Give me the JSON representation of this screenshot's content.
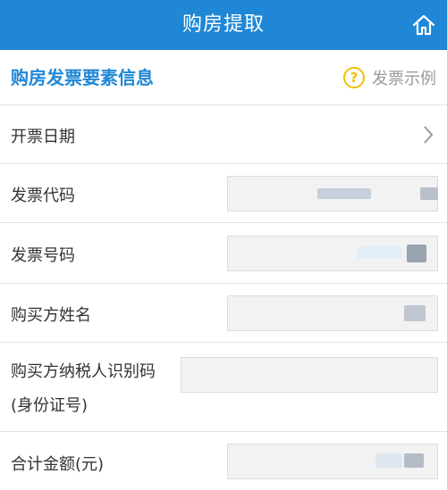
{
  "header": {
    "title": "购房提取",
    "home_icon": "home-icon"
  },
  "section": {
    "title": "购房发票要素信息",
    "sample_icon_glyph": "?",
    "sample_label": "发票示例"
  },
  "fields": {
    "invoice_date": {
      "label": "开票日期",
      "value": ""
    },
    "invoice_code": {
      "label": "发票代码",
      "value": ""
    },
    "invoice_number": {
      "label": "发票号码",
      "value": ""
    },
    "buyer_name": {
      "label": "购买方姓名",
      "value": ""
    },
    "buyer_tax_id": {
      "label_line1": "购买方纳税人识别码",
      "label_line2": "(身份证号)",
      "value": ""
    },
    "total_amount": {
      "label": "合计金额(元)",
      "value": ""
    }
  },
  "colors": {
    "header_bg": "#1f87d6",
    "accent": "#1f87d6",
    "hint": "#f0c000"
  }
}
